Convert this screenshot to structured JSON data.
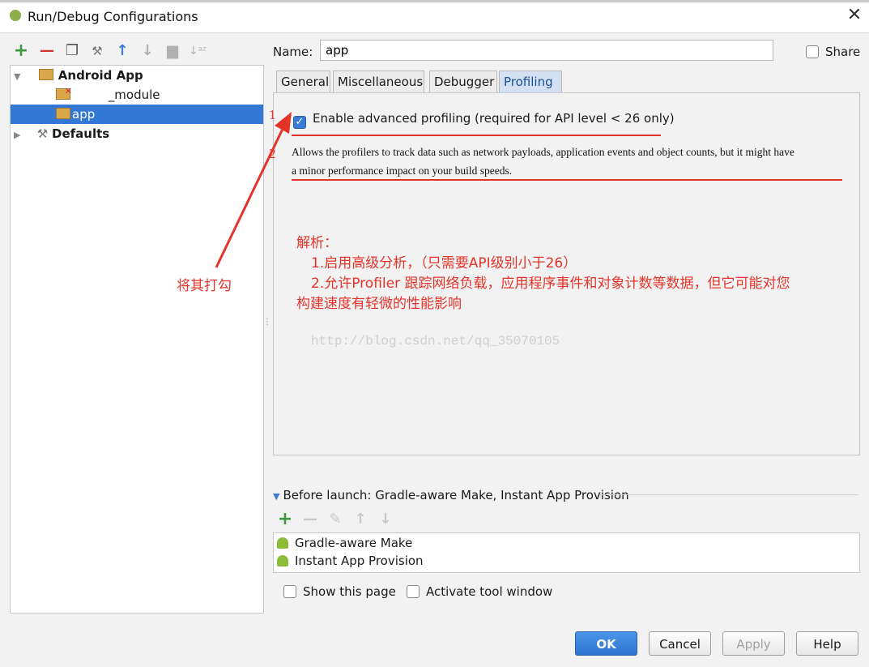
{
  "window": {
    "title": "Run/Debug Configurations"
  },
  "toolbar": [
    {
      "name": "add-icon",
      "glyph": "+",
      "color": "#3c9a3c"
    },
    {
      "name": "remove-icon",
      "glyph": "—",
      "color": "#d03030"
    },
    {
      "name": "copy-icon",
      "glyph": "❐",
      "color": "#555"
    },
    {
      "name": "wrench-icon",
      "glyph": "🔧",
      "color": "#777"
    },
    {
      "name": "move-up-icon",
      "glyph": "🡑",
      "color": "#3a7bd5"
    },
    {
      "name": "move-down-icon",
      "glyph": "🡓",
      "color": "#b0b0b0"
    },
    {
      "name": "folder-icon",
      "glyph": "▬",
      "color": "#b0b0b0"
    },
    {
      "name": "sort-icon",
      "glyph": "⇅",
      "color": "#b0b0b0"
    }
  ],
  "tree": {
    "android_app": "Android App",
    "module": "_module",
    "app": "app",
    "defaults": "Defaults"
  },
  "form": {
    "name_label": "Name:",
    "name_value": "app",
    "share_label": "Share"
  },
  "tabs": [
    "General",
    "Miscellaneous",
    "Debugger",
    "Profiling"
  ],
  "profiling": {
    "enable_label": "Enable advanced profiling (required for API level < 26 only)",
    "enable_checked": true,
    "description_line1": "Allows the profilers to track data such as network payloads, application events and object counts, but it might have",
    "description_line2": "a minor performance impact on your build speeds."
  },
  "annotations": {
    "marker1": "1",
    "marker2": "2",
    "check_note": "将其打勾",
    "analysis_title": "解析：",
    "analysis_1": "1.启用高级分析，（只需要API级别小于26）",
    "analysis_2": "2.允许Profiler 跟踪网络负载，应用程序事件和对象计数等数据，但它可能对您",
    "analysis_3": "构建速度有轻微的性能影响",
    "watermark": "http://blog.csdn.net/qq_35070105"
  },
  "before_launch": {
    "header": "Before launch: Gradle-aware Make, Instant App Provision",
    "items": [
      "Gradle-aware Make",
      "Instant App Provision"
    ]
  },
  "options": {
    "show_page": "Show this page",
    "activate_tool": "Activate tool window"
  },
  "buttons": {
    "ok": "OK",
    "cancel": "Cancel",
    "apply": "Apply",
    "help": "Help"
  },
  "colors": {
    "accent": "#3478d6",
    "annotation": "#e4342a"
  }
}
